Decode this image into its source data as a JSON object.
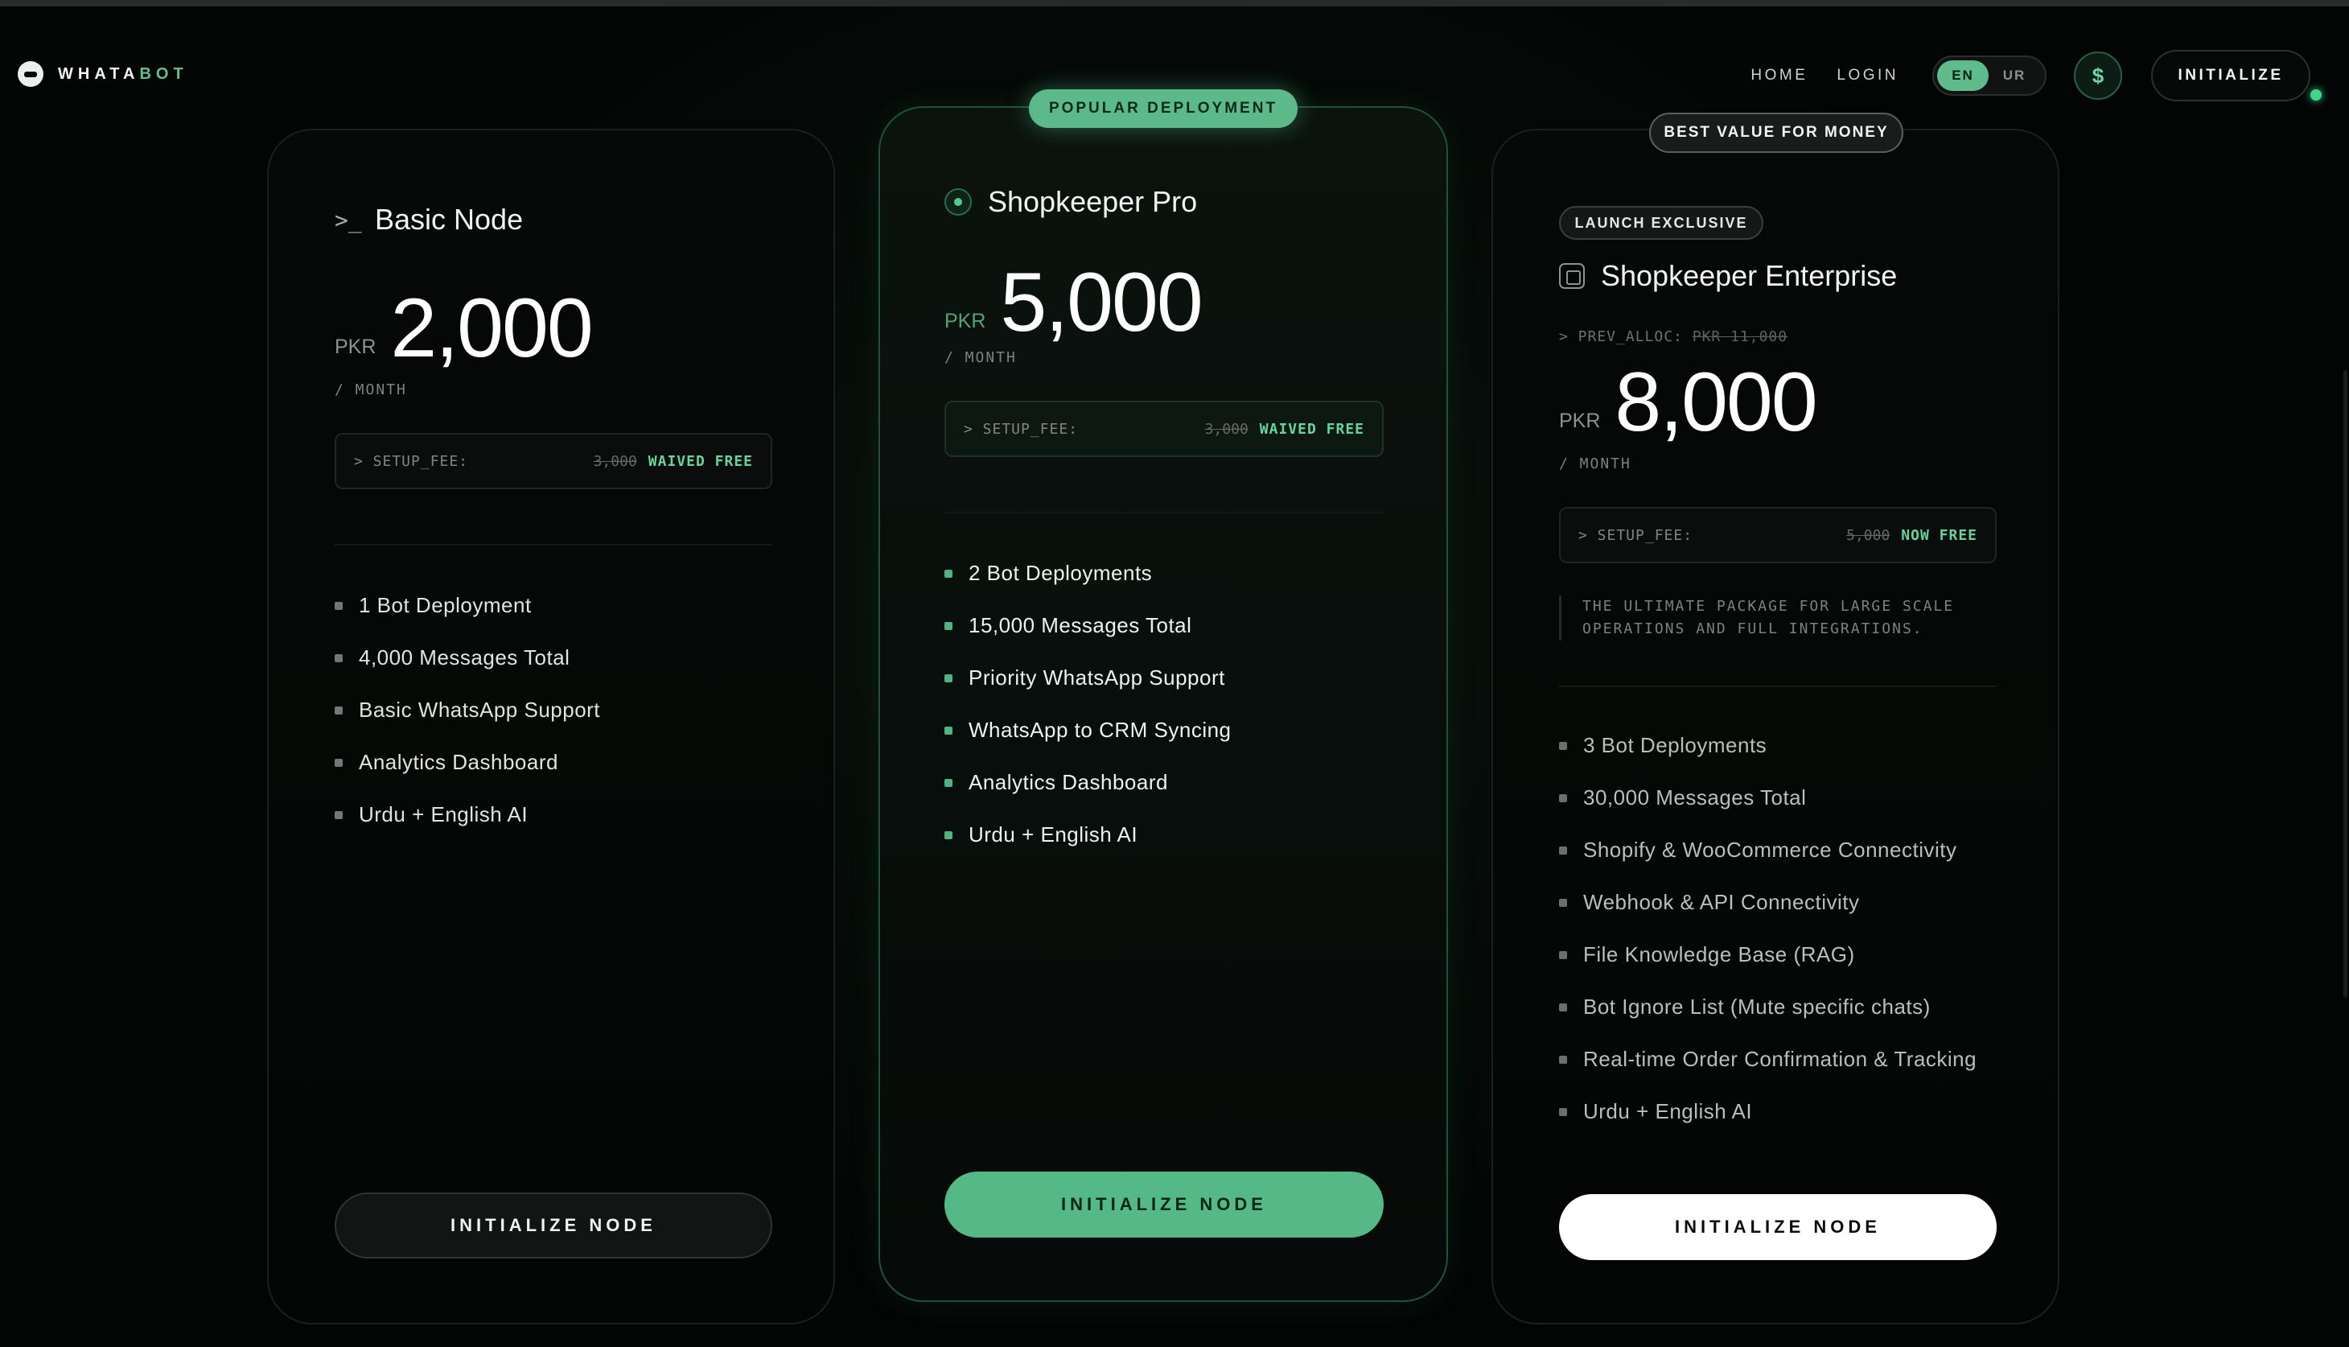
{
  "brand": {
    "name_part1": "WHATA",
    "name_part2": "BOT"
  },
  "nav": {
    "home": "HOME",
    "login": "LOGIN",
    "lang_en": "EN",
    "lang_ur": "UR",
    "currency_symbol": "$",
    "initialize": "INITIALIZE"
  },
  "colors": {
    "accent": "#5cb98a",
    "background": "#030504",
    "status": "#3fd58a"
  },
  "plans": [
    {
      "title": "Basic Node",
      "icon": "terminal-prompt-icon",
      "currency": "PKR",
      "amount": "2,000",
      "period": "/ MONTH",
      "setup_label": "> SETUP_FEE:",
      "setup_old": "3,000",
      "setup_new": "WAIVED FREE",
      "features": [
        "1 Bot Deployment",
        "4,000 Messages Total",
        "Basic WhatsApp Support",
        "Analytics Dashboard",
        "Urdu + English AI"
      ],
      "cta": "INITIALIZE NODE"
    },
    {
      "badge": "POPULAR DEPLOYMENT",
      "title": "Shopkeeper Pro",
      "icon": "radio-dot-icon",
      "currency": "PKR",
      "amount": "5,000",
      "period": "/ MONTH",
      "setup_label": "> SETUP_FEE:",
      "setup_old": "3,000",
      "setup_new": "WAIVED FREE",
      "features": [
        "2 Bot Deployments",
        "15,000 Messages Total",
        "Priority WhatsApp Support",
        "WhatsApp to CRM Syncing",
        "Analytics Dashboard",
        "Urdu + English AI"
      ],
      "cta": "INITIALIZE NODE"
    },
    {
      "badge": "BEST VALUE FOR MONEY",
      "tag": "LAUNCH EXCLUSIVE",
      "title": "Shopkeeper Enterprise",
      "icon": "cpu-chip-icon",
      "prev_label": "> PREV_ALLOC:",
      "prev_value": "PKR 11,000",
      "currency": "PKR",
      "amount": "8,000",
      "period": "/ MONTH",
      "setup_label": "> SETUP_FEE:",
      "setup_old": "5,000",
      "setup_new": "NOW FREE",
      "description_line1": "THE ULTIMATE PACKAGE FOR LARGE SCALE",
      "description_line2": "OPERATIONS AND FULL INTEGRATIONS.",
      "features": [
        "3 Bot Deployments",
        "30,000 Messages Total",
        "Shopify & WooCommerce Connectivity",
        "Webhook & API Connectivity",
        "File Knowledge Base (RAG)",
        "Bot Ignore List (Mute specific chats)",
        "Real-time Order Confirmation & Tracking",
        "Urdu + English AI"
      ],
      "cta": "INITIALIZE NODE"
    }
  ]
}
